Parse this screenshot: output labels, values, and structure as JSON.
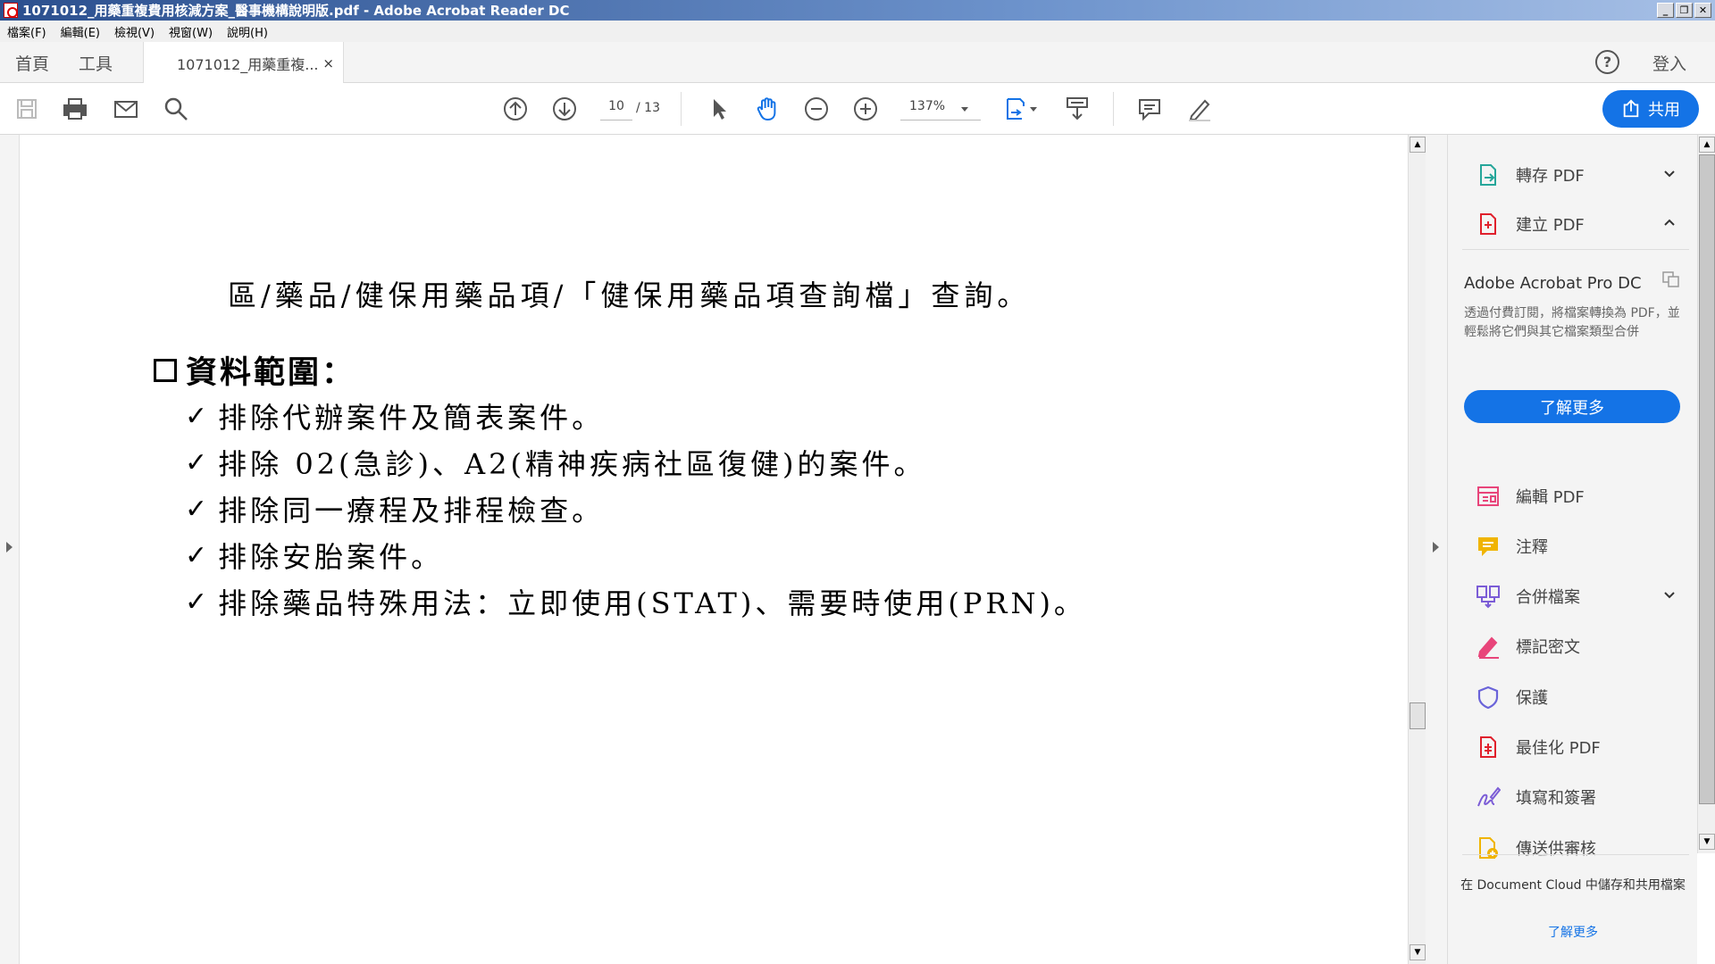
{
  "window": {
    "title": "1071012_用藥重複費用核減方案_醫事機構說明版.pdf - Adobe Acrobat Reader DC"
  },
  "menu": [
    "檔案(F)",
    "編輯(E)",
    "檢視(V)",
    "視窗(W)",
    "說明(H)"
  ],
  "tabs": {
    "home": "首頁",
    "tools": "工具",
    "document": "1071012_用藥重複...",
    "close": "×",
    "signin": "登入"
  },
  "toolbar": {
    "page_current": "10",
    "page_total": "/ 13",
    "zoom": "137%",
    "share_label": "共用"
  },
  "document": {
    "line1": "區/藥品/健保用藥品項/「健保用藥品項查詢檔」查詢。",
    "section_heading": "資料範圍：",
    "bullets": [
      "排除代辦案件及簡表案件。",
      "排除 02(急診)、A2(精神疾病社區復健)的案件。",
      "排除同一療程及排程檢查。",
      "排除安胎案件。",
      "排除藥品特殊用法：立即使用(STAT)、需要時使用(PRN)。"
    ]
  },
  "right_pane": {
    "export_pdf": "轉存 PDF",
    "create_pdf": "建立 PDF",
    "promo_title": "Adobe Acrobat Pro DC",
    "promo_text": "透過付費訂閱，將檔案轉換為 PDF，並輕鬆將它們與其它檔案類型合併",
    "learn_more": "了解更多",
    "tools": [
      {
        "label": "編輯 PDF",
        "icon": "edit-pdf-icon",
        "color": "#e8457a"
      },
      {
        "label": "注釋",
        "icon": "comment-icon",
        "color": "#f0b400"
      },
      {
        "label": "合併檔案",
        "icon": "combine-files-icon",
        "color": "#7b5cd6"
      },
      {
        "label": "標記密文",
        "icon": "redact-icon",
        "color": "#e8457a"
      },
      {
        "label": "保護",
        "icon": "protect-icon",
        "color": "#6a63d9"
      },
      {
        "label": "最佳化 PDF",
        "icon": "optimize-pdf-icon",
        "color": "#e0202c"
      },
      {
        "label": "填寫和簽署",
        "icon": "fill-sign-icon",
        "color": "#7b5cd6"
      },
      {
        "label": "傳送供審核",
        "icon": "send-review-icon",
        "color": "#f0b400"
      }
    ],
    "cloud_text": "在 Document Cloud 中儲存和共用檔案",
    "cloud_link": "了解更多"
  }
}
